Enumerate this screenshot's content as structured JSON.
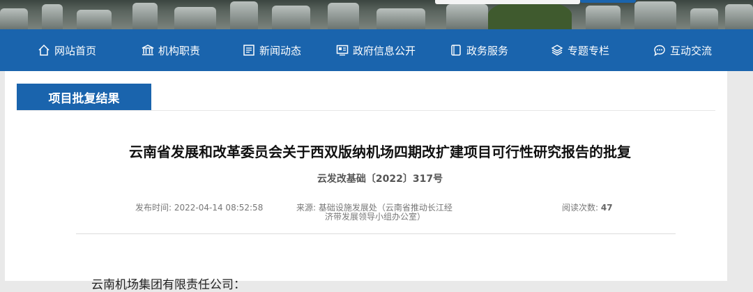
{
  "nav": {
    "items": [
      {
        "label": "网站首页",
        "icon": "home-icon"
      },
      {
        "label": "机构职责",
        "icon": "institution-icon"
      },
      {
        "label": "新闻动态",
        "icon": "news-icon"
      },
      {
        "label": "政府信息公开",
        "icon": "disclosure-icon"
      },
      {
        "label": "政务服务",
        "icon": "service-icon"
      },
      {
        "label": "专题专栏",
        "icon": "layers-icon"
      },
      {
        "label": "互动交流",
        "icon": "chat-icon"
      }
    ]
  },
  "section": {
    "tab_label": "项目批复结果"
  },
  "article": {
    "title": "云南省发展和改革委员会关于西双版纳机场四期改扩建项目可行性研究报告的批复",
    "doc_number": "云发改基础〔2022〕317号",
    "publish_label": "发布时间:",
    "publish_time": "2022-04-14 08:52:58",
    "source_label": "来源:",
    "source_line1": "基础设施发展处（云南省推动长江经",
    "source_line2": "济带发展领导小组办公室）",
    "views_label": "阅读次数:",
    "views": "47",
    "recipient": "云南机场集团有限责任公司："
  },
  "colors": {
    "brand_blue": "#1a64ad",
    "background": "#e9e9e9"
  }
}
